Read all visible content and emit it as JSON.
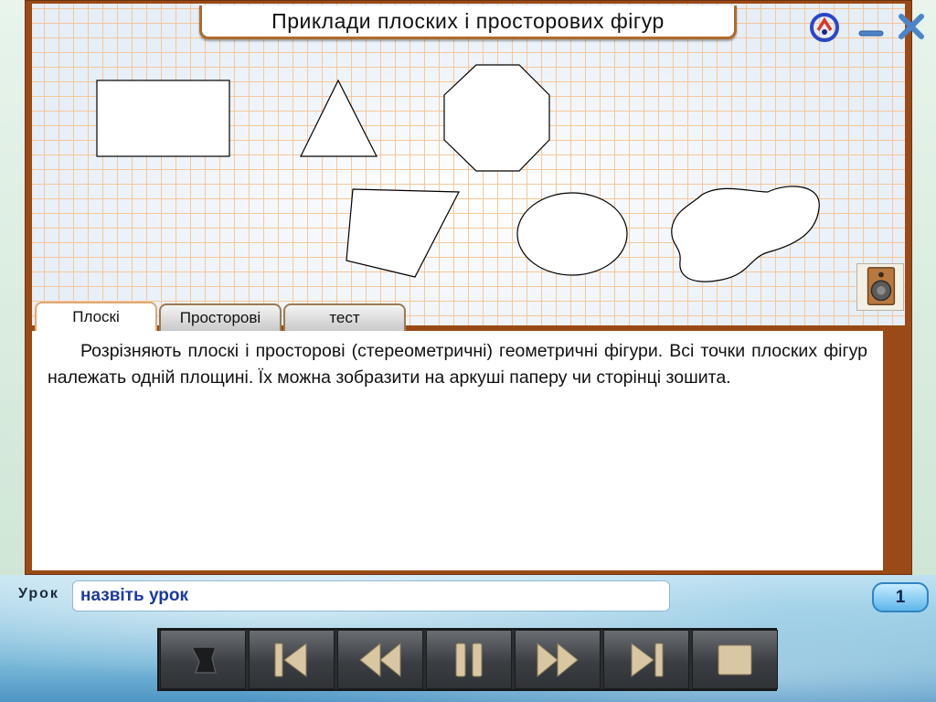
{
  "window": {
    "title": "Приклади плоских і просторових фігур"
  },
  "tabs": [
    {
      "label": "Плоскі",
      "active": true
    },
    {
      "label": "Просторові",
      "active": false
    },
    {
      "label": "тест",
      "active": false
    }
  ],
  "content": {
    "text": "Розрізняють плоскі і просторові (стереометричні) геометричні фігури. Всі точки плоских фігур належать одній площині. Їх можна зобразити на аркуші паперу чи сторінці зошита."
  },
  "lesson": {
    "label": "Урок",
    "name": "назвіть урок",
    "page": "1"
  },
  "icons": {
    "help": "help-icon",
    "minimize": "minimize-icon",
    "close": "close-icon",
    "speaker": "speaker-icon"
  },
  "colors": {
    "frame": "#9a4a16",
    "grid": "#f5c79a",
    "lesson_text": "#1c3a9a",
    "nav_bg": "#2a2d31"
  }
}
